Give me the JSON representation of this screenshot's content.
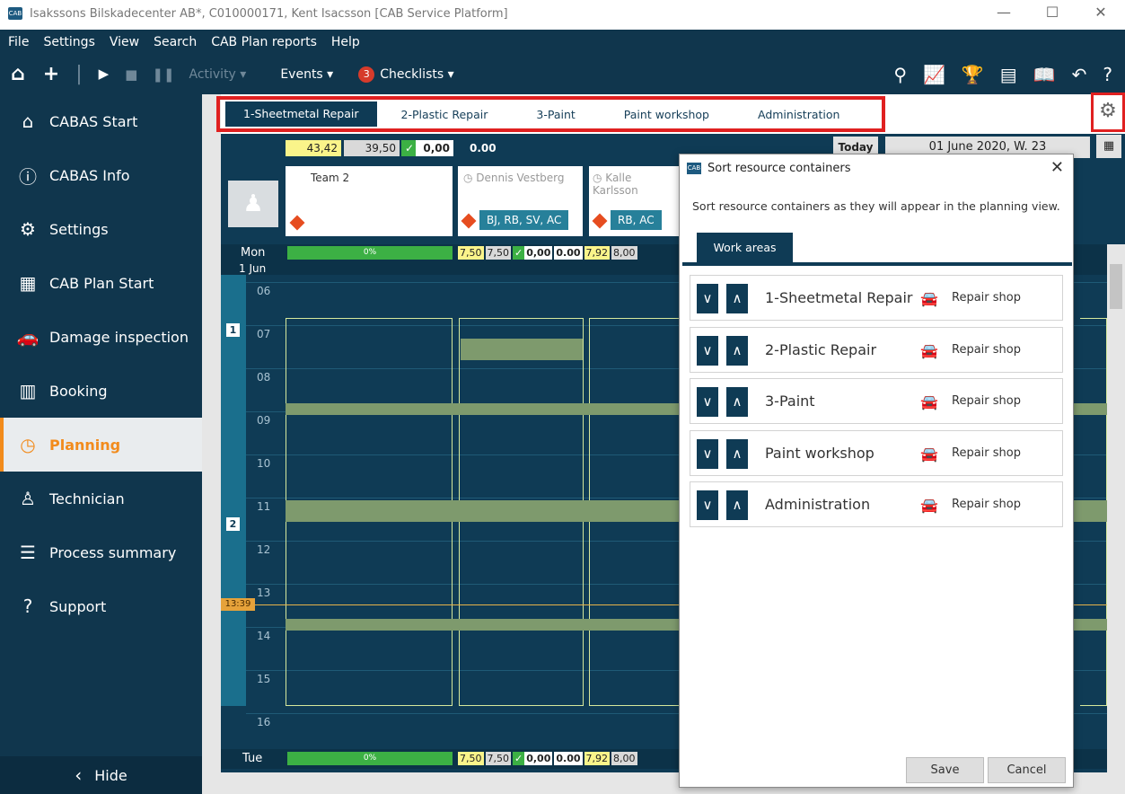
{
  "window": {
    "title": "Isakssons Bilskadecenter AB*, C010000171, Kent Isacsson [CAB Service Platform]",
    "logo": "CAB",
    "minimize": "—",
    "maximize": "☐",
    "close": "✕"
  },
  "menu": [
    "File",
    "Settings",
    "View",
    "Search",
    "CAB Plan reports",
    "Help"
  ],
  "toolbar": {
    "home_icon": "home-icon",
    "add_icon": "plus-icon",
    "activity": "Activity ▾",
    "events": "Events ▾",
    "checklists_badge": "3",
    "checklists": "Checklists ▾"
  },
  "sidebar": {
    "items": [
      {
        "label": "CABAS Start",
        "icon": "home-icon"
      },
      {
        "label": "CABAS Info",
        "icon": "info-icon"
      },
      {
        "label": "Settings",
        "icon": "gear-icon"
      },
      {
        "label": "CAB Plan Start",
        "icon": "grid-icon"
      },
      {
        "label": "Damage inspection",
        "icon": "car-icon"
      },
      {
        "label": "Booking",
        "icon": "calendar-icon"
      },
      {
        "label": "Planning",
        "icon": "clock-icon"
      },
      {
        "label": "Technician",
        "icon": "technician-icon"
      },
      {
        "label": "Process summary",
        "icon": "list-icon"
      },
      {
        "label": "Support",
        "icon": "help-icon"
      }
    ],
    "hide": "Hide",
    "active_index": 6
  },
  "tabs": [
    "1-Sheetmetal Repair",
    "2-Plastic Repair",
    "3-Paint",
    "Paint workshop",
    "Administration"
  ],
  "planning": {
    "summary": {
      "v1": "43,42",
      "v2": "39,50",
      "v3": "0,00",
      "v4": "0.00"
    },
    "today": "Today",
    "date": "01 June 2020, W. 23",
    "resources": [
      {
        "name": "Team 2"
      },
      {
        "name": "Dennis Vestberg",
        "skills": "BJ, RB, SV, AC"
      },
      {
        "name": "Kalle Karlsson",
        "skills": "RB, AC"
      }
    ],
    "day1": {
      "day": "Mon",
      "date": "1 Jun",
      "pct": "0%",
      "vals": [
        "7,50",
        "7,50",
        "0,00",
        "0.00",
        "7,92",
        "8,00"
      ]
    },
    "day2": {
      "day": "Tue",
      "pct": "0%",
      "vals": [
        "7,50",
        "7,50",
        "0,00",
        "0.00",
        "7,92",
        "8,00"
      ]
    },
    "hours": [
      "06",
      "07",
      "08",
      "09",
      "10",
      "11",
      "12",
      "13",
      "14",
      "15",
      "16"
    ],
    "now": "13:39",
    "markers": [
      "1",
      "2"
    ]
  },
  "dialog": {
    "title": "Sort resource containers",
    "subtitle": "Sort resource containers as they will appear in the planning view.",
    "tab": "Work areas",
    "rows": [
      {
        "label": "1-Sheetmetal Repair",
        "type": "Repair shop"
      },
      {
        "label": "2-Plastic Repair",
        "type": "Repair shop"
      },
      {
        "label": "3-Paint",
        "type": "Repair shop"
      },
      {
        "label": "Paint workshop",
        "type": "Repair shop"
      },
      {
        "label": "Administration",
        "type": "Repair shop"
      }
    ],
    "save": "Save",
    "cancel": "Cancel"
  }
}
